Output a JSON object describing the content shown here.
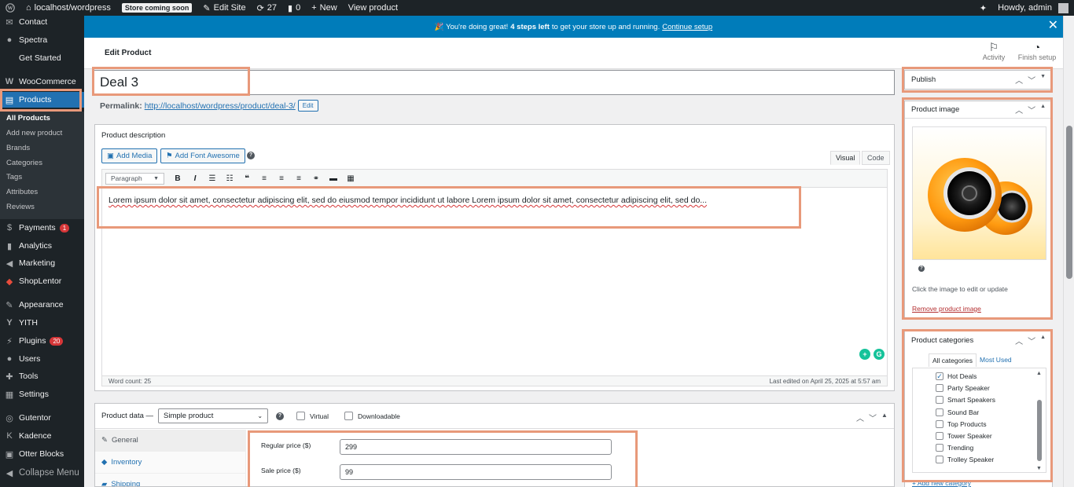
{
  "adminbar": {
    "site": "localhost/wordpress",
    "store_badge": "Store coming soon",
    "edit_site": "Edit Site",
    "updates_count": "27",
    "comments_count": "0",
    "new": "New",
    "view_product": "View product",
    "howdy": "Howdy, admin"
  },
  "sidebar": {
    "contact": "Contact",
    "spectra": "Spectra",
    "get_started": "Get Started",
    "woocommerce": "WooCommerce",
    "products": "Products",
    "sub": [
      "All Products",
      "Add new product",
      "Brands",
      "Categories",
      "Tags",
      "Attributes",
      "Reviews"
    ],
    "payments": "Payments",
    "payments_badge": "1",
    "analytics": "Analytics",
    "marketing": "Marketing",
    "shoplentor": "ShopLentor",
    "appearance": "Appearance",
    "yith": "YITH",
    "plugins": "Plugins",
    "plugins_badge": "20",
    "users": "Users",
    "tools": "Tools",
    "settings": "Settings",
    "gutentor": "Gutentor",
    "kadence": "Kadence",
    "otter": "Otter Blocks",
    "collapse": "Collapse Menu"
  },
  "notice": {
    "text_before": "🎉 You're doing great!",
    "strong": "4 steps left",
    "text_after": "to get your store up and running.",
    "link": "Continue setup"
  },
  "header": {
    "title": "Edit Product",
    "activity": "Activity",
    "finish_setup": "Finish setup"
  },
  "product": {
    "title": "Deal 3",
    "permalink_label": "Permalink:",
    "permalink_url": "http://localhost/wordpress/product/deal-3/",
    "edit_label": "Edit"
  },
  "description": {
    "box_title": "Product description",
    "add_media": "Add Media",
    "add_font_awesome": "Add Font Awesome",
    "tab_visual": "Visual",
    "tab_code": "Code",
    "format": "Paragraph",
    "content": "Lorem ipsum dolor sit amet, consectetur adipiscing elit, sed do eiusmod tempor incididunt ut labore Lorem ipsum dolor sit amet, consectetur adipiscing elit, sed do...",
    "word_count": "Word count: 25",
    "last_edited": "Last edited on April 25, 2025 at 5:57 am"
  },
  "product_data": {
    "label": "Product data —",
    "type": "Simple product",
    "virtual": "Virtual",
    "downloadable": "Downloadable",
    "tabs": [
      "General",
      "Inventory",
      "Shipping"
    ],
    "regular_price_label": "Regular price ($)",
    "regular_price": "299",
    "sale_price_label": "Sale price ($)",
    "sale_price": "99"
  },
  "publish": {
    "title": "Publish"
  },
  "product_image": {
    "title": "Product image",
    "hint": "Click the image to edit or update",
    "remove": "Remove product image"
  },
  "categories": {
    "title": "Product categories",
    "tab_all": "All categories",
    "tab_most_used": "Most Used",
    "items": [
      {
        "name": "Hot Deals",
        "checked": true
      },
      {
        "name": "Party Speaker",
        "checked": false
      },
      {
        "name": "Smart Speakers",
        "checked": false
      },
      {
        "name": "Sound Bar",
        "checked": false
      },
      {
        "name": "Top Products",
        "checked": false
      },
      {
        "name": "Tower Speaker",
        "checked": false
      },
      {
        "name": "Trending",
        "checked": false
      },
      {
        "name": "Trolley Speaker",
        "checked": false
      }
    ],
    "add_new": "+ Add new category"
  }
}
